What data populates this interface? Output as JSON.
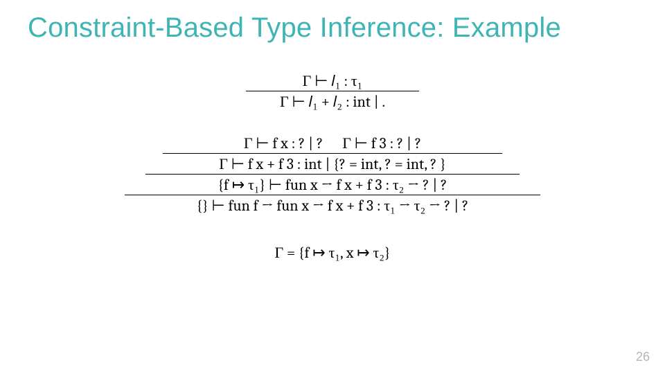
{
  "title": "Constraint-Based Type Inference: Example",
  "page": "26",
  "top_rule": {
    "premise": "Γ ⊢ 𝑙₁ : τ₁",
    "conclusion": "Γ ⊢ 𝑙₁ + 𝑙₂ : int | ."
  },
  "big_rule": {
    "p_fx": "Γ ⊢ f x : ? | ?",
    "p_f3": "Γ ⊢ f 3 : ? | ?",
    "sum": "Γ ⊢ f x + f 3 : int | {? = int, ? = int, ? }",
    "fun_x": "{f ↦ τ₁} ⊢ fun x → f x + f 3 : τ₂ → ? | ?",
    "fun_f": "{} ⊢ fun f → fun x → f x + f 3 : τ₁ → τ₂ → ? | ?"
  },
  "gamma": "Γ = {f ↦ τ₁, x ↦ τ₂}"
}
